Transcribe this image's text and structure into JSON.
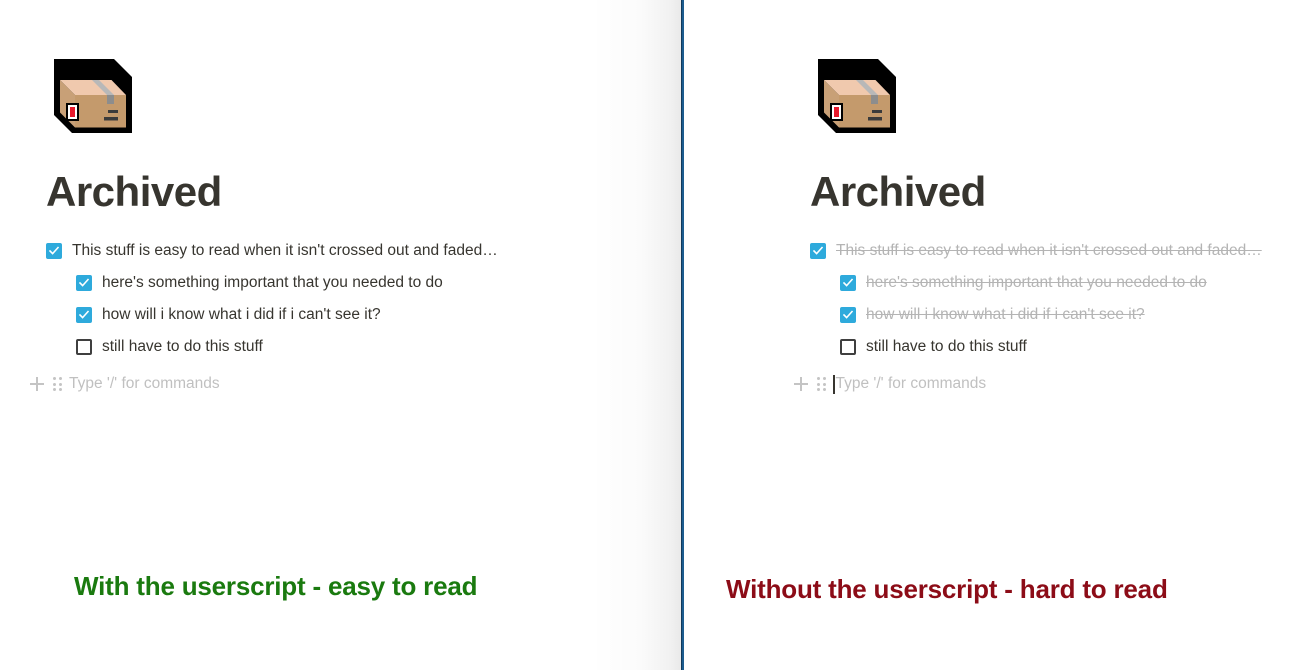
{
  "divider": {
    "color": "#1d5c8e"
  },
  "colors": {
    "checkbox_checked": "#2eaadc",
    "text": "#37352f",
    "faded_text": "#b4b4b4",
    "placeholder": "#c0c0c0",
    "caption_green": "#1a7a0f",
    "caption_red": "#8c0c17"
  },
  "panels": [
    {
      "id": "with-userscript",
      "page_icon": "package-box-emoji",
      "title": "Archived",
      "todos": [
        {
          "text": "This stuff is easy to read when it isn't crossed out and faded…",
          "checked": true,
          "indent": 0,
          "faded": false
        },
        {
          "text": "here's something important that you needed to do",
          "checked": true,
          "indent": 1,
          "faded": false
        },
        {
          "text": "how will i know what i did if i can't see it?",
          "checked": true,
          "indent": 1,
          "faded": false
        },
        {
          "text": "still have to do this stuff",
          "checked": false,
          "indent": 1,
          "faded": false
        }
      ],
      "placeholder": "Type '/' for commands",
      "caret_visible": false,
      "caption": "With the userscript - easy to read"
    },
    {
      "id": "without-userscript",
      "page_icon": "package-box-emoji",
      "title": "Archived",
      "todos": [
        {
          "text": "This stuff is easy to read when it isn't crossed out and faded…",
          "checked": true,
          "indent": 0,
          "faded": true
        },
        {
          "text": "here's something important that you needed to do",
          "checked": true,
          "indent": 1,
          "faded": true
        },
        {
          "text": "how will i know what i did if i can't see it?",
          "checked": true,
          "indent": 1,
          "faded": true
        },
        {
          "text": "still have to do this stuff",
          "checked": false,
          "indent": 1,
          "faded": false
        }
      ],
      "placeholder": "Type '/' for commands",
      "caret_visible": true,
      "caption": "Without the userscript - hard to read"
    }
  ]
}
